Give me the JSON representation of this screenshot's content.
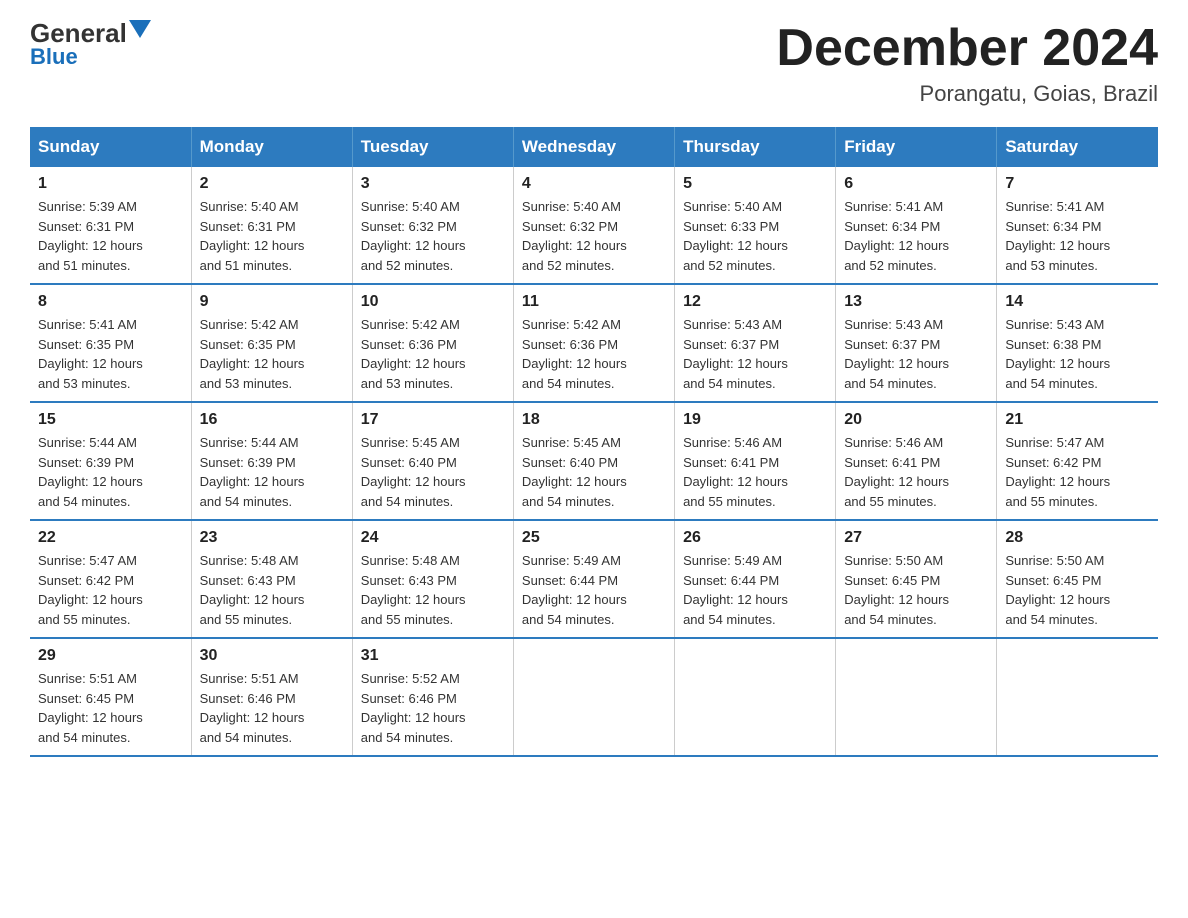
{
  "header": {
    "logo_general": "General",
    "logo_blue": "Blue",
    "month": "December 2024",
    "location": "Porangatu, Goias, Brazil"
  },
  "days_of_week": [
    "Sunday",
    "Monday",
    "Tuesday",
    "Wednesday",
    "Thursday",
    "Friday",
    "Saturday"
  ],
  "weeks": [
    [
      {
        "day": "1",
        "sunrise": "5:39 AM",
        "sunset": "6:31 PM",
        "daylight": "12 hours and 51 minutes."
      },
      {
        "day": "2",
        "sunrise": "5:40 AM",
        "sunset": "6:31 PM",
        "daylight": "12 hours and 51 minutes."
      },
      {
        "day": "3",
        "sunrise": "5:40 AM",
        "sunset": "6:32 PM",
        "daylight": "12 hours and 52 minutes."
      },
      {
        "day": "4",
        "sunrise": "5:40 AM",
        "sunset": "6:32 PM",
        "daylight": "12 hours and 52 minutes."
      },
      {
        "day": "5",
        "sunrise": "5:40 AM",
        "sunset": "6:33 PM",
        "daylight": "12 hours and 52 minutes."
      },
      {
        "day": "6",
        "sunrise": "5:41 AM",
        "sunset": "6:34 PM",
        "daylight": "12 hours and 52 minutes."
      },
      {
        "day": "7",
        "sunrise": "5:41 AM",
        "sunset": "6:34 PM",
        "daylight": "12 hours and 53 minutes."
      }
    ],
    [
      {
        "day": "8",
        "sunrise": "5:41 AM",
        "sunset": "6:35 PM",
        "daylight": "12 hours and 53 minutes."
      },
      {
        "day": "9",
        "sunrise": "5:42 AM",
        "sunset": "6:35 PM",
        "daylight": "12 hours and 53 minutes."
      },
      {
        "day": "10",
        "sunrise": "5:42 AM",
        "sunset": "6:36 PM",
        "daylight": "12 hours and 53 minutes."
      },
      {
        "day": "11",
        "sunrise": "5:42 AM",
        "sunset": "6:36 PM",
        "daylight": "12 hours and 54 minutes."
      },
      {
        "day": "12",
        "sunrise": "5:43 AM",
        "sunset": "6:37 PM",
        "daylight": "12 hours and 54 minutes."
      },
      {
        "day": "13",
        "sunrise": "5:43 AM",
        "sunset": "6:37 PM",
        "daylight": "12 hours and 54 minutes."
      },
      {
        "day": "14",
        "sunrise": "5:43 AM",
        "sunset": "6:38 PM",
        "daylight": "12 hours and 54 minutes."
      }
    ],
    [
      {
        "day": "15",
        "sunrise": "5:44 AM",
        "sunset": "6:39 PM",
        "daylight": "12 hours and 54 minutes."
      },
      {
        "day": "16",
        "sunrise": "5:44 AM",
        "sunset": "6:39 PM",
        "daylight": "12 hours and 54 minutes."
      },
      {
        "day": "17",
        "sunrise": "5:45 AM",
        "sunset": "6:40 PM",
        "daylight": "12 hours and 54 minutes."
      },
      {
        "day": "18",
        "sunrise": "5:45 AM",
        "sunset": "6:40 PM",
        "daylight": "12 hours and 54 minutes."
      },
      {
        "day": "19",
        "sunrise": "5:46 AM",
        "sunset": "6:41 PM",
        "daylight": "12 hours and 55 minutes."
      },
      {
        "day": "20",
        "sunrise": "5:46 AM",
        "sunset": "6:41 PM",
        "daylight": "12 hours and 55 minutes."
      },
      {
        "day": "21",
        "sunrise": "5:47 AM",
        "sunset": "6:42 PM",
        "daylight": "12 hours and 55 minutes."
      }
    ],
    [
      {
        "day": "22",
        "sunrise": "5:47 AM",
        "sunset": "6:42 PM",
        "daylight": "12 hours and 55 minutes."
      },
      {
        "day": "23",
        "sunrise": "5:48 AM",
        "sunset": "6:43 PM",
        "daylight": "12 hours and 55 minutes."
      },
      {
        "day": "24",
        "sunrise": "5:48 AM",
        "sunset": "6:43 PM",
        "daylight": "12 hours and 55 minutes."
      },
      {
        "day": "25",
        "sunrise": "5:49 AM",
        "sunset": "6:44 PM",
        "daylight": "12 hours and 54 minutes."
      },
      {
        "day": "26",
        "sunrise": "5:49 AM",
        "sunset": "6:44 PM",
        "daylight": "12 hours and 54 minutes."
      },
      {
        "day": "27",
        "sunrise": "5:50 AM",
        "sunset": "6:45 PM",
        "daylight": "12 hours and 54 minutes."
      },
      {
        "day": "28",
        "sunrise": "5:50 AM",
        "sunset": "6:45 PM",
        "daylight": "12 hours and 54 minutes."
      }
    ],
    [
      {
        "day": "29",
        "sunrise": "5:51 AM",
        "sunset": "6:45 PM",
        "daylight": "12 hours and 54 minutes."
      },
      {
        "day": "30",
        "sunrise": "5:51 AM",
        "sunset": "6:46 PM",
        "daylight": "12 hours and 54 minutes."
      },
      {
        "day": "31",
        "sunrise": "5:52 AM",
        "sunset": "6:46 PM",
        "daylight": "12 hours and 54 minutes."
      },
      null,
      null,
      null,
      null
    ]
  ],
  "labels": {
    "sunrise": "Sunrise:",
    "sunset": "Sunset:",
    "daylight": "Daylight:"
  }
}
